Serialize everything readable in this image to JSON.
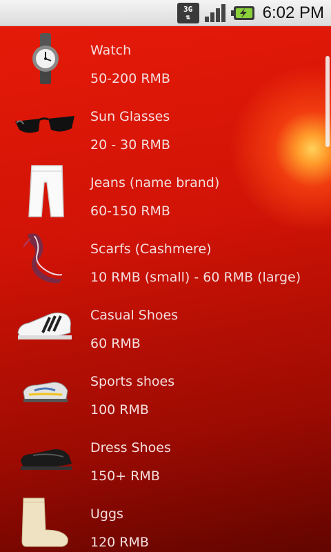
{
  "status_bar": {
    "network_label_top": "3G",
    "network_label_bottom": "⇅",
    "time": "6:02 PM"
  },
  "items": [
    {
      "name": "Watch",
      "price": "50-200 RMB",
      "icon": "watch-icon"
    },
    {
      "name": "Sun Glasses",
      "price": "20 - 30 RMB",
      "icon": "sunglasses-icon"
    },
    {
      "name": "Jeans (name brand)",
      "price": "60-150 RMB",
      "icon": "jeans-icon"
    },
    {
      "name": "Scarfs (Cashmere)",
      "price": "10 RMB (small) - 60 RMB (large)",
      "icon": "scarf-icon"
    },
    {
      "name": "Casual Shoes",
      "price": "60 RMB",
      "icon": "casual-shoe-icon"
    },
    {
      "name": "Sports shoes",
      "price": "100 RMB",
      "icon": "sports-shoe-icon"
    },
    {
      "name": "Dress Shoes",
      "price": "150+ RMB",
      "icon": "dress-shoe-icon"
    },
    {
      "name": "Uggs",
      "price": "120 RMB",
      "icon": "uggs-icon"
    }
  ],
  "colors": {
    "background_top": "#e51a08",
    "background_bottom": "#620500",
    "text": "#f4dede"
  }
}
